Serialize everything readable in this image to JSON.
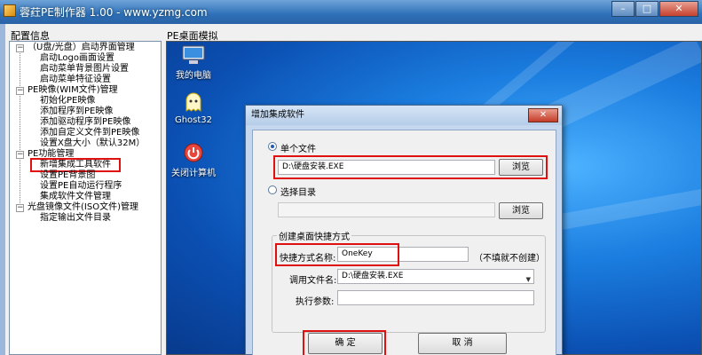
{
  "window": {
    "title": "蓉荭PE制作器 1.00 - www.yzmg.com",
    "buttons": {
      "minimize": "–",
      "maximize": "□",
      "close": "✕"
    }
  },
  "panels": {
    "config_label": "配置信息",
    "desktop_label": "PE桌面模拟"
  },
  "tree": {
    "groups": [
      {
        "label": "（U盘/光盘）启动界面管理",
        "toggle": "−",
        "children": [
          "启动Logo画面设置",
          "启动菜单背景图片设置",
          "启动菜单特征设置"
        ]
      },
      {
        "label": "PE映像(WIM文件)管理",
        "toggle": "−",
        "children": [
          "初始化PE映像",
          "添加程序到PE映像",
          "添加驱动程序到PE映像",
          "添加自定义文件到PE映像",
          "设置X盘大小（默认32M）"
        ]
      },
      {
        "label": "PE功能管理",
        "toggle": "−",
        "children": [
          "新增集成工具软件",
          "设置PE背景图",
          "设置PE自动运行程序",
          "集成软件文件管理"
        ]
      },
      {
        "label": "光盘镜像文件(ISO文件)管理",
        "toggle": "−",
        "children": [
          "指定输出文件目录"
        ]
      }
    ],
    "selected": "新增集成工具软件"
  },
  "desktop_icons": [
    {
      "label": "我的电脑",
      "icon": "computer-icon"
    },
    {
      "label": "Ghost32",
      "icon": "ghost-icon"
    },
    {
      "label": "关闭计算机",
      "icon": "power-icon"
    }
  ],
  "dialog": {
    "title": "增加集成软件",
    "close": "✕",
    "single_file": {
      "label": "单个文件",
      "value": "D:\\硬盘安装.EXE",
      "browse": "浏览",
      "selected": true
    },
    "select_dir": {
      "label": "选择目录",
      "value": "",
      "browse": "浏览",
      "selected": false
    },
    "shortcut_group": {
      "label": "创建桌面快捷方式",
      "name_label": "快捷方式名称:",
      "name_value": "OneKey",
      "name_hint": "（不填就不创建）",
      "file_label": "调用文件名:",
      "file_value": "D:\\硬盘安装.EXE",
      "params_label": "执行参数:",
      "params_value": ""
    },
    "ok": "确 定",
    "cancel": "取 消"
  },
  "colors": {
    "highlight": "#e01010",
    "desktop": "#1b7ee0",
    "titlebar": "#2e70b8"
  }
}
